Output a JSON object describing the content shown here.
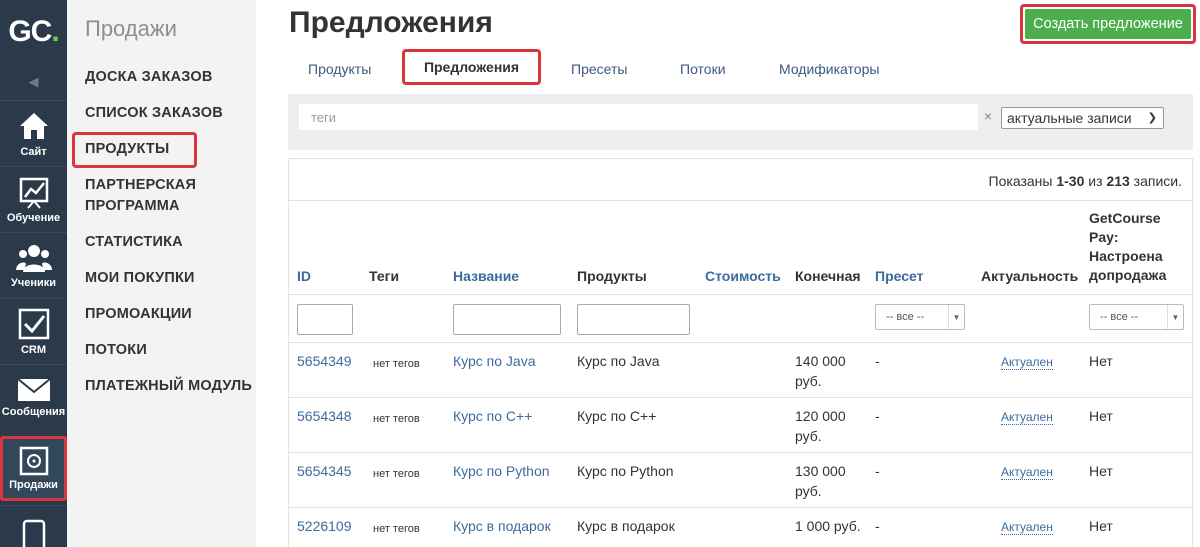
{
  "rail": {
    "logo_main": "GC",
    "logo_dot": ".",
    "items": [
      {
        "label": "Сайт",
        "icon": "home-icon"
      },
      {
        "label": "Обучение",
        "icon": "chart-board-icon"
      },
      {
        "label": "Ученики",
        "icon": "users-icon"
      },
      {
        "label": "CRM",
        "icon": "checkbox-icon"
      },
      {
        "label": "Сообщения",
        "icon": "envelope-icon"
      },
      {
        "label": "Продажи",
        "icon": "safe-icon"
      },
      {
        "label": "",
        "icon": "phone-icon"
      }
    ]
  },
  "sidebar": {
    "title": "Продажи",
    "items": [
      {
        "label": "ДОСКА ЗАКАЗОВ"
      },
      {
        "label": "СПИСОК ЗАКАЗОВ"
      },
      {
        "label": "ПРОДУКТЫ"
      },
      {
        "label": "ПАРТНЕРСКАЯ ПРОГРАММА"
      },
      {
        "label": "СТАТИСТИКА"
      },
      {
        "label": "МОИ ПОКУПКИ"
      },
      {
        "label": "ПРОМОАКЦИИ"
      },
      {
        "label": "ПОТОКИ"
      },
      {
        "label": "ПЛАТЕЖНЫЙ МОДУЛЬ"
      }
    ]
  },
  "header": {
    "title": "Предложения",
    "create_button": "Создать предложение"
  },
  "tabs": [
    {
      "label": "Продукты"
    },
    {
      "label": "Предложения"
    },
    {
      "label": "Пресеты"
    },
    {
      "label": "Потоки"
    },
    {
      "label": "Модификаторы"
    }
  ],
  "filters": {
    "tags_placeholder": "теги",
    "clear": "×",
    "status_value": "актуальные записи",
    "select_all": "-- все --"
  },
  "summary": {
    "prefix": "Показаны ",
    "range": "1-30",
    "middle": " из ",
    "total": "213",
    "suffix": " записи."
  },
  "table": {
    "headers": {
      "id": "ID",
      "tags": "Теги",
      "name": "Название",
      "products": "Продукты",
      "price": "Стоимость",
      "final_line1": "Конечная",
      "preset": "Пресет",
      "actual": "Актуальность",
      "gcpay_line1": "GetCourse",
      "gcpay_line2": "Pay:",
      "gcpay_line3": "Настроена",
      "gcpay_line4": "допродажа"
    },
    "rows": [
      {
        "id": "5654349",
        "tags": "нет тегов",
        "name": "Курс по Java",
        "product": "Курс по Java",
        "final_1": "140 000",
        "final_2": "руб.",
        "preset": "-",
        "actual": "Актуален",
        "gcpay": "Нет"
      },
      {
        "id": "5654348",
        "tags": "нет тегов",
        "name": "Курс по C++",
        "product": "Курс по C++",
        "final_1": "120 000",
        "final_2": "руб.",
        "preset": "-",
        "actual": "Актуален",
        "gcpay": "Нет"
      },
      {
        "id": "5654345",
        "tags": "нет тегов",
        "name": "Курс по Python",
        "product": "Курс по Python",
        "final_1": "130 000",
        "final_2": "руб.",
        "preset": "-",
        "actual": "Актуален",
        "gcpay": "Нет"
      },
      {
        "id": "5226109",
        "tags": "нет тегов",
        "name": "Курс в подарок",
        "product": "Курс в подарок",
        "final_1": "1 000 руб.",
        "final_2": "",
        "preset": "-",
        "actual": "Актуален",
        "gcpay": "Нет"
      }
    ]
  },
  "colors": {
    "rail_bg": "#2b3a4a",
    "accent_green": "#4cae4c",
    "highlight_red": "#d9363e",
    "link_blue": "#3d6b9e"
  }
}
